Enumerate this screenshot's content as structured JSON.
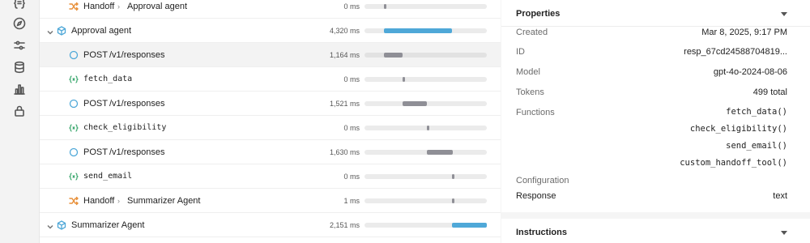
{
  "trace": {
    "rows": [
      {
        "label": "Handoff",
        "target": "Approval agent",
        "duration": "0 ms"
      },
      {
        "label": "Approval agent",
        "duration": "4,320 ms"
      },
      {
        "method": "POST",
        "path": "/v1/responses",
        "duration": "1,164 ms"
      },
      {
        "label": "fetch_data",
        "duration": "0 ms"
      },
      {
        "method": "POST",
        "path": "/v1/responses",
        "duration": "1,521 ms"
      },
      {
        "label": "check_eligibility",
        "duration": "0 ms"
      },
      {
        "method": "POST",
        "path": "/v1/responses",
        "duration": "1,630 ms"
      },
      {
        "label": "send_email",
        "duration": "0 ms"
      },
      {
        "label": "Handoff",
        "target": "Summarizer Agent",
        "duration": "1 ms"
      },
      {
        "label": "Summarizer Agent",
        "duration": "2,151 ms"
      }
    ]
  },
  "properties": {
    "title": "Properties",
    "created_label": "Created",
    "created_value": "Mar 8, 2025, 9:17 PM",
    "id_label": "ID",
    "id_value": "resp_67cd24588704819...",
    "model_label": "Model",
    "model_value": "gpt-4o-2024-08-06",
    "tokens_label": "Tokens",
    "tokens_value": "499 total",
    "functions_label": "Functions",
    "functions": [
      "fetch_data()",
      "check_eligibility()",
      "send_email()",
      "custom_handoff_tool()"
    ],
    "configuration_label": "Configuration",
    "response_label": "Response",
    "response_value": "text"
  },
  "instructions": {
    "title": "Instructions"
  },
  "colors": {
    "accent_blue": "#4fa8d8",
    "bar_gray": "#8f8f96",
    "handoff_orange": "#e8903a",
    "function_green": "#3aa76d"
  }
}
